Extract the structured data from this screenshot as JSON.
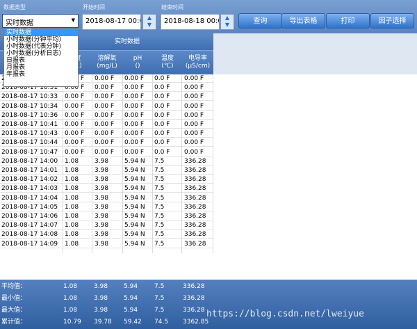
{
  "toolbar": {
    "data_type_label": "数据类型",
    "data_type_value": "实时数据",
    "start_label": "开始时间",
    "start_value": "2018-08-17 00:00",
    "end_label": "结束时间",
    "end_value": "2018-08-18 00:00",
    "buttons": [
      "查询",
      "导出表格",
      "打印",
      "因子选择"
    ]
  },
  "dropdown": {
    "options": [
      "实时数据",
      "小时数据(分钟平均)",
      "小时数据(代表分钟)",
      "小时数据(分析日志)",
      "日报表",
      "月报表",
      "年报表"
    ]
  },
  "table": {
    "group_header": "实时数据",
    "columns": [
      {
        "line1": "度",
        "line2": "/L)"
      },
      {
        "line1": "溶解氧",
        "line2": "(mg/L)"
      },
      {
        "line1": "pH",
        "line2": "()"
      },
      {
        "line1": "温度",
        "line2": "(℃)"
      },
      {
        "line1": "电导率",
        "line2": "(μS/cm)"
      }
    ],
    "rows": [
      [
        "2018-08-17 10:1",
        "0.00 F",
        "0.00 F",
        "0.00 F",
        "0.0 F",
        "0.00 F"
      ],
      [
        "2018-08-17 10:31",
        "0.00 F",
        "0.00 F",
        "0.00 F",
        "0.0 F",
        "0.00 F"
      ],
      [
        "2018-08-17 10:33",
        "0.00 F",
        "0.00 F",
        "0.00 F",
        "0.0 F",
        "0.00 F"
      ],
      [
        "2018-08-17 10:34",
        "0.00 F",
        "0.00 F",
        "0.00 F",
        "0.0 F",
        "0.00 F"
      ],
      [
        "2018-08-17 10:36",
        "0.00 F",
        "0.00 F",
        "0.00 F",
        "0.0 F",
        "0.00 F"
      ],
      [
        "2018-08-17 10:41",
        "0.00 F",
        "0.00 F",
        "0.00 F",
        "0.0 F",
        "0.00 F"
      ],
      [
        "2018-08-17 10:43",
        "0.00 F",
        "0.00 F",
        "0.00 F",
        "0.0 F",
        "0.00 F"
      ],
      [
        "2018-08-17 10:44",
        "0.00 F",
        "0.00 F",
        "0.00 F",
        "0.0 F",
        "0.00 F"
      ],
      [
        "2018-08-17 10:47",
        "0.00 F",
        "0.00 F",
        "0.00 F",
        "0.0 F",
        "0.00 F"
      ],
      [
        "2018-08-17 14:00",
        "1.08",
        "3.98",
        "5.94 N",
        "7.5",
        "336.28"
      ],
      [
        "2018-08-17 14:01",
        "1.08",
        "3.98",
        "5.94 N",
        "7.5",
        "336.28"
      ],
      [
        "2018-08-17 14:02",
        "1.08",
        "3.98",
        "5.94 N",
        "7.5",
        "336.28"
      ],
      [
        "2018-08-17 14:03",
        "1.08",
        "3.98",
        "5.94 N",
        "7.5",
        "336.28"
      ],
      [
        "2018-08-17 14:04",
        "1.08",
        "3.98",
        "5.94 N",
        "7.5",
        "336.28"
      ],
      [
        "2018-08-17 14:05",
        "1.08",
        "3.98",
        "5.94 N",
        "7.5",
        "336.28"
      ],
      [
        "2018-08-17 14:06",
        "1.08",
        "3.98",
        "5.94 N",
        "7.5",
        "336.28"
      ],
      [
        "2018-08-17 14:07",
        "1.08",
        "3.98",
        "5.94 N",
        "7.5",
        "336.28"
      ],
      [
        "2018-08-17 14:08",
        "1.08",
        "3.98",
        "5.94 N",
        "7.5",
        "336.28"
      ],
      [
        "2018-08-17 14:09",
        "1.08",
        "3.98",
        "5.94 N",
        "7.5",
        "336.28"
      ]
    ]
  },
  "summary": [
    [
      "平均值：",
      "1.08",
      "3.98",
      "5.94",
      "7.5",
      "336.28"
    ],
    [
      "最小值：",
      "1.08",
      "3.98",
      "5.94",
      "7.5",
      "336.28"
    ],
    [
      "最大值：",
      "1.08",
      "3.98",
      "5.94",
      "7.5",
      "336.28"
    ],
    [
      "累计值：",
      "10.79",
      "39.78",
      "59.42",
      "74.5",
      "3362.85"
    ]
  ],
  "watermark": "https://blog.csdn.net/lweiyue",
  "colors": {
    "toolbar": "#5a85c1",
    "selection": "#3399ff",
    "footer": "#2f5f9f"
  }
}
